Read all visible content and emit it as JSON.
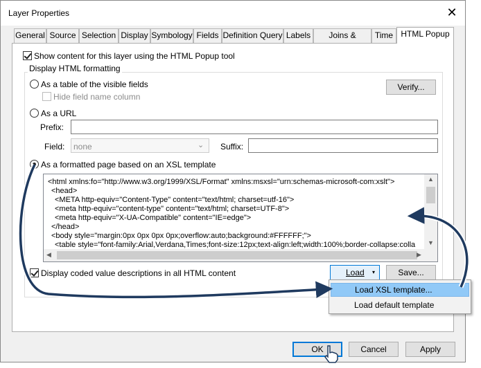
{
  "window": {
    "title": "Layer Properties",
    "close_glyph": "✕"
  },
  "tabs": [
    {
      "label": "General"
    },
    {
      "label": "Source"
    },
    {
      "label": "Selection"
    },
    {
      "label": "Display"
    },
    {
      "label": "Symbology"
    },
    {
      "label": "Fields"
    },
    {
      "label": "Definition Query"
    },
    {
      "label": "Labels"
    },
    {
      "label": "Joins & Relates"
    },
    {
      "label": "Time"
    },
    {
      "label": "HTML Popup",
      "active": true
    }
  ],
  "popup": {
    "show_content_label": "Show content for this layer using the HTML Popup tool",
    "show_content_checked": true,
    "group_title": "Display HTML formatting",
    "table_option": "As a table of the visible fields",
    "hide_field_label": "Hide field name column",
    "verify_button": "Verify...",
    "url_option": "As a URL",
    "prefix_label": "Prefix:",
    "prefix_value": "",
    "field_label": "Field:",
    "field_value": "none",
    "suffix_label": "Suffix:",
    "suffix_value": "",
    "xsl_option": "As a formatted page based on an XSL template",
    "xsl_selected": true,
    "code_lines": [
      "<html xmlns:fo=\"http://www.w3.org/1999/XSL/Format\" xmlns:msxsl=\"urn:schemas-microsoft-com:xslt\">",
      "  <head>",
      "    <META http-equiv=\"Content-Type\" content=\"text/html; charset=utf-16\">",
      "    <meta http-equiv=\"content-type\" content=\"text/html; charset=UTF-8\">",
      "    <meta http-equiv=\"X-UA-Compatible\" content=\"IE=edge\">",
      "  </head>",
      "  <body style=\"margin:0px 0px 0px 0px;overflow:auto;background:#FFFFFF;\">",
      "    <table style=\"font-family:Arial,Verdana,Times;font-size:12px;text-align:left;width:100%;border-collapse:colla"
    ],
    "coded_values_label": "Display coded value descriptions in all HTML content",
    "coded_values_checked": true,
    "load_button": "Load",
    "save_button": "Save...",
    "load_menu": [
      "Load XSL template...",
      "Load default template"
    ]
  },
  "footer": {
    "ok": "OK",
    "cancel": "Cancel",
    "apply": "Apply"
  },
  "colors": {
    "menu_highlight": "#91c9f7",
    "arrow": "#1f3a5f",
    "default_button_border": "#0078d7"
  }
}
